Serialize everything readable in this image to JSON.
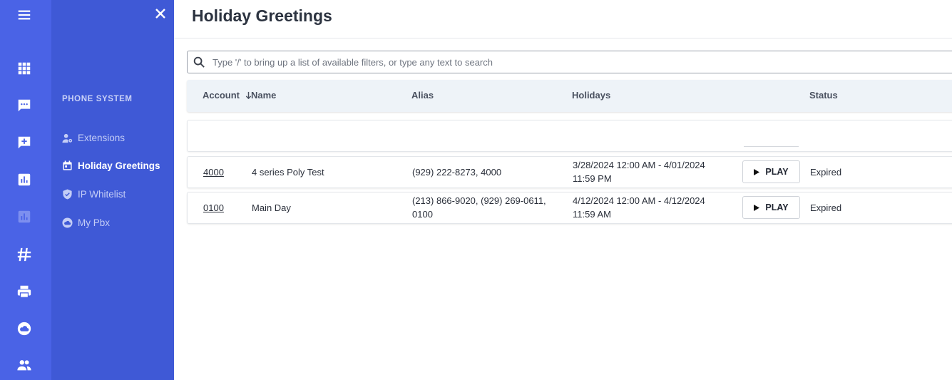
{
  "rail": {
    "icons": [
      "menu-icon",
      "apps-grid-icon",
      "chat-icon",
      "add-comment-icon",
      "analytics-icon",
      "analytics-dim-icon",
      "hashtag-icon",
      "printer-icon",
      "cloud-icon",
      "people-icon"
    ]
  },
  "sidebar": {
    "section_title": "PHONE SYSTEM",
    "items": [
      {
        "label": "Extensions",
        "icon": "person-gear-icon",
        "active": false
      },
      {
        "label": "Holiday Greetings",
        "icon": "calendar-icon",
        "active": true
      },
      {
        "label": "IP Whitelist",
        "icon": "shield-icon",
        "active": false
      },
      {
        "label": "My Pbx",
        "icon": "cloud-icon",
        "active": false
      }
    ]
  },
  "page": {
    "title": "Holiday Greetings"
  },
  "search": {
    "placeholder": "Type '/' to bring up a list of available filters, or type any text to search",
    "value": ""
  },
  "table": {
    "columns": {
      "account": "Account",
      "name": "Name",
      "alias": "Alias",
      "holidays": "Holidays",
      "status": "Status"
    },
    "rows": [
      {
        "account": "4000",
        "name": "4 series Poly Test",
        "alias_line1": "(929) 222-8273, 4000",
        "alias_line2": "",
        "holidays_line1": "3/28/2024 12:00 AM - 4/01/2024",
        "holidays_line2": "11:59 PM",
        "play_label": "PLAY",
        "status": "Expired"
      },
      {
        "account": "0100",
        "name": "Main Day",
        "alias_line1": "(213) 866-9020, (929) 269-0611,",
        "alias_line2": "0100",
        "holidays_line1": "4/12/2024 12:00 AM - 4/12/2024",
        "holidays_line2": "11:59 AM",
        "play_label": "PLAY",
        "status": "Expired"
      }
    ]
  },
  "colors": {
    "rail": "#4a63e6",
    "sidebar": "#3f59d6",
    "header_row": "#eef3f8"
  }
}
